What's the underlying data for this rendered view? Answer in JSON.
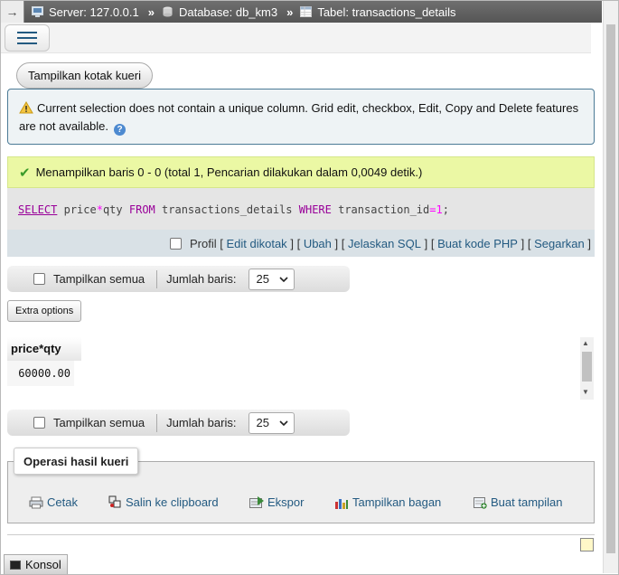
{
  "breadcrumb": {
    "back_glyph": "→",
    "server": "Server: 127.0.0.1",
    "database": "Database: db_km3",
    "table": "Tabel: transactions_details",
    "sep": "»"
  },
  "query_box_button": "Tampilkan kotak kueri",
  "notice": {
    "text": "Current selection does not contain a unique column. Grid edit, checkbox, Edit, Copy and Delete features are not available."
  },
  "success": {
    "text": "Menampilkan baris 0 - 0 (total 1, Pencarian dilakukan dalam 0,0049 detik.)"
  },
  "sql": {
    "select": "SELECT",
    "expr_a": "price",
    "op": "*",
    "expr_b": "qty",
    "from": "FROM",
    "table": "transactions_details",
    "where": "WHERE",
    "col": "transaction_id",
    "eq": "=",
    "val": "1",
    "end": ";"
  },
  "sql_links": {
    "profil": "Profil",
    "edit": "Edit dikotak",
    "ubah": "Ubah",
    "jelaskan": "Jelaskan SQL",
    "buat_kode": "Buat kode PHP",
    "segarkan": "Segarkan",
    "lb": "[",
    "rb": "]"
  },
  "nav": {
    "show_all": "Tampilkan semua",
    "rows_label": "Jumlah baris:",
    "rows_value": "25"
  },
  "extra_options": "Extra options",
  "results": {
    "header": "price*qty",
    "value": "60000.00"
  },
  "operations": {
    "legend": "Operasi hasil kueri",
    "items": [
      "Cetak",
      "Salin ke clipboard",
      "Ekspor",
      "Tampilkan bagan",
      "Buat tampilan"
    ]
  },
  "console": "Konsol"
}
